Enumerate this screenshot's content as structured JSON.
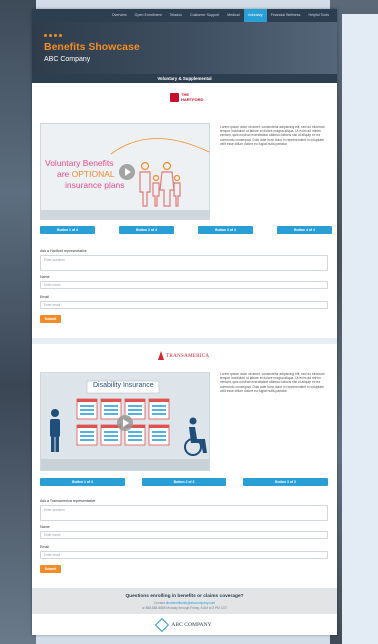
{
  "nav": {
    "items": [
      "Overview",
      "Open Enrollment",
      "Teladoc",
      "Customer Support",
      "Medical",
      "Voluntary",
      "Financial Wellness",
      "Helpful Tools"
    ],
    "active_index": 5
  },
  "hero": {
    "title": "Benefits Showcase",
    "subtitle": "ABC Company"
  },
  "band": {
    "title": "Voluntary & Supplemental"
  },
  "hartford": {
    "logo": {
      "line1": "THE",
      "line2": "HARTFORD"
    },
    "video": {
      "line1": "Voluntary Benefits",
      "line2_a": "are ",
      "line2_b": "OPTIONAL",
      "line3": "insurance plans"
    },
    "lorem": "Lorem ipsum dolor sit amet, consectetur adipiscing elit, sed do eiusmod tempor incididunt ut labore et dolore magna aliqua. Ut enim ad minim veniam, quis nostrud exercitation ullamco laboris nisi ut aliquip ex ea commodo consequat. Duis aute irure dolor in reprehenderit in voluptate velit esse cillum dolore eu fugiat nulla pariatur.",
    "buttons": [
      "Button 1 of 4",
      "Button 2 of 4",
      "Button 3 of 4",
      "Button 4 of 4"
    ],
    "form": {
      "ask_label": "Ask a Hartford representative",
      "question_placeholder": "Enter question",
      "name_label": "Name",
      "name_placeholder": "Enter name",
      "email_label": "Email",
      "email_placeholder": "Enter email",
      "submit": "Submit"
    }
  },
  "transamerica": {
    "logo": "TRANSAMERICA",
    "video": {
      "title": "Disability Insurance"
    },
    "lorem": "Lorem ipsum dolor sit amet, consectetur adipiscing elit, sed do eiusmod tempor incididunt ut labore et dolore magna aliqua. Ut enim ad minim veniam, quis nostrud exercitation ullamco laboris nisi ut aliquip ex ea commodo consequat. Duis aute irure dolor in reprehenderit in voluptate velit esse cillum dolore eu fugiat nulla pariatur.",
    "buttons": [
      "Button 1 of 3",
      "Button 2 of 3",
      "Button 3 of 3"
    ],
    "form": {
      "ask_label": "Ask a Transamerica representative",
      "question_placeholder": "Enter question",
      "name_label": "Name",
      "name_placeholder": "Enter name",
      "email_label": "Email",
      "email_placeholder": "Enter email",
      "submit": "Submit"
    }
  },
  "footer": {
    "question": "Questions enrolling in benefits or claims coverage?",
    "contact_prefix": "Contact ",
    "contact_email": "abcbenefitsinfo@abccompany.com",
    "hours": "or 888-888-8888 Monday through Friday, 8 AM to 5 PM CST",
    "company": "ABC COMPANY"
  },
  "colors": {
    "accent": "#f28c28",
    "primary": "#2a9fd6",
    "dark": "#2c3e50"
  }
}
